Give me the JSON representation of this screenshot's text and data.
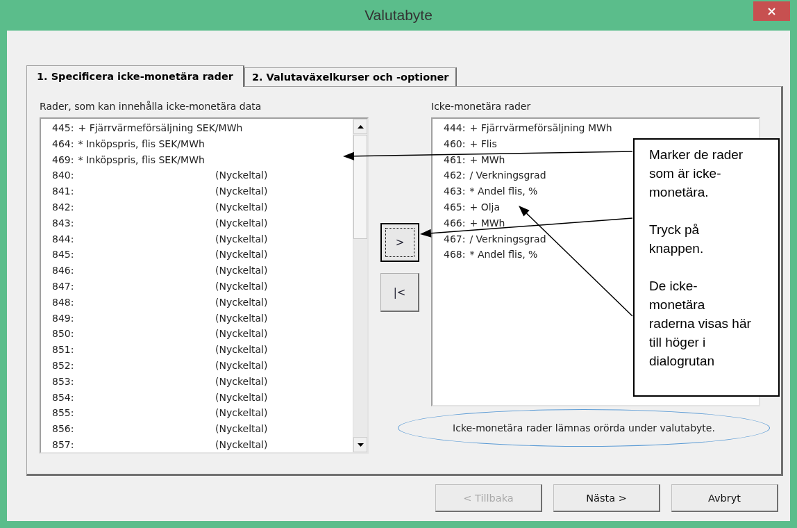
{
  "window": {
    "title": "Valutabyte"
  },
  "tabs": [
    {
      "label": "1. Specificera icke-monetära rader",
      "selected": true
    },
    {
      "label": "2. Valutaväxelkurser och -optioner",
      "selected": false
    }
  ],
  "available_list": {
    "label": "Rader, som kan innehålla icke-monetära data",
    "items": [
      {
        "kind": "entry",
        "number": "445:",
        "text": "+ Fjärrvärmeförsäljning SEK/MWh"
      },
      {
        "kind": "entry",
        "number": "464:",
        "text": "* Inköpspris, flis SEK/MWh"
      },
      {
        "kind": "entry",
        "number": "469:",
        "text": "* Inköpspris, flis SEK/MWh"
      },
      {
        "kind": "key_figure",
        "number": "840:",
        "text": "(Nyckeltal)"
      },
      {
        "kind": "key_figure",
        "number": "841:",
        "text": "(Nyckeltal)"
      },
      {
        "kind": "key_figure",
        "number": "842:",
        "text": "(Nyckeltal)"
      },
      {
        "kind": "key_figure",
        "number": "843:",
        "text": "(Nyckeltal)"
      },
      {
        "kind": "key_figure",
        "number": "844:",
        "text": "(Nyckeltal)"
      },
      {
        "kind": "key_figure",
        "number": "845:",
        "text": "(Nyckeltal)"
      },
      {
        "kind": "key_figure",
        "number": "846:",
        "text": "(Nyckeltal)"
      },
      {
        "kind": "key_figure",
        "number": "847:",
        "text": "(Nyckeltal)"
      },
      {
        "kind": "key_figure",
        "number": "848:",
        "text": "(Nyckeltal)"
      },
      {
        "kind": "key_figure",
        "number": "849:",
        "text": "(Nyckeltal)"
      },
      {
        "kind": "key_figure",
        "number": "850:",
        "text": "(Nyckeltal)"
      },
      {
        "kind": "key_figure",
        "number": "851:",
        "text": "(Nyckeltal)"
      },
      {
        "kind": "key_figure",
        "number": "852:",
        "text": "(Nyckeltal)"
      },
      {
        "kind": "key_figure",
        "number": "853:",
        "text": "(Nyckeltal)"
      },
      {
        "kind": "key_figure",
        "number": "854:",
        "text": "(Nyckeltal)"
      },
      {
        "kind": "key_figure",
        "number": "855:",
        "text": "(Nyckeltal)"
      },
      {
        "kind": "key_figure",
        "number": "856:",
        "text": "(Nyckeltal)"
      },
      {
        "kind": "key_figure",
        "number": "857:",
        "text": "(Nyckeltal)"
      }
    ]
  },
  "move_buttons": [
    {
      "label": ">",
      "focused": true
    },
    {
      "label": "|<",
      "focused": false
    }
  ],
  "selected_list": {
    "label": "Icke-monetära rader",
    "items": [
      {
        "kind": "entry",
        "number": "444:",
        "text": "+ Fjärrvärmeförsäljning MWh"
      },
      {
        "kind": "entry",
        "number": "460:",
        "text": "+ Flis"
      },
      {
        "kind": "entry",
        "number": "461:",
        "text": "+ MWh"
      },
      {
        "kind": "entry",
        "number": "462:",
        "text": "/ Verkningsgrad"
      },
      {
        "kind": "entry",
        "number": "463:",
        "text": "* Andel flis, %"
      },
      {
        "kind": "entry",
        "number": "465:",
        "text": "+ Olja"
      },
      {
        "kind": "entry",
        "number": "466:",
        "text": "+ MWh"
      },
      {
        "kind": "entry",
        "number": "467:",
        "text": "/ Verkningsgrad"
      },
      {
        "kind": "entry",
        "number": "468:",
        "text": "* Andel flis, %"
      }
    ]
  },
  "hint": "Icke-monetära rader lämnas orörda under valutabyte.",
  "callout": [
    "Marker de rader som är icke-monetära.",
    "Tryck på knappen.",
    "De icke-monetära raderna visas här till höger i dialogrutan"
  ],
  "buttons": [
    {
      "label": "< Tillbaka",
      "disabled": true
    },
    {
      "label": "Nästa >",
      "disabled": false
    },
    {
      "label": "Avbryt",
      "disabled": false
    }
  ]
}
